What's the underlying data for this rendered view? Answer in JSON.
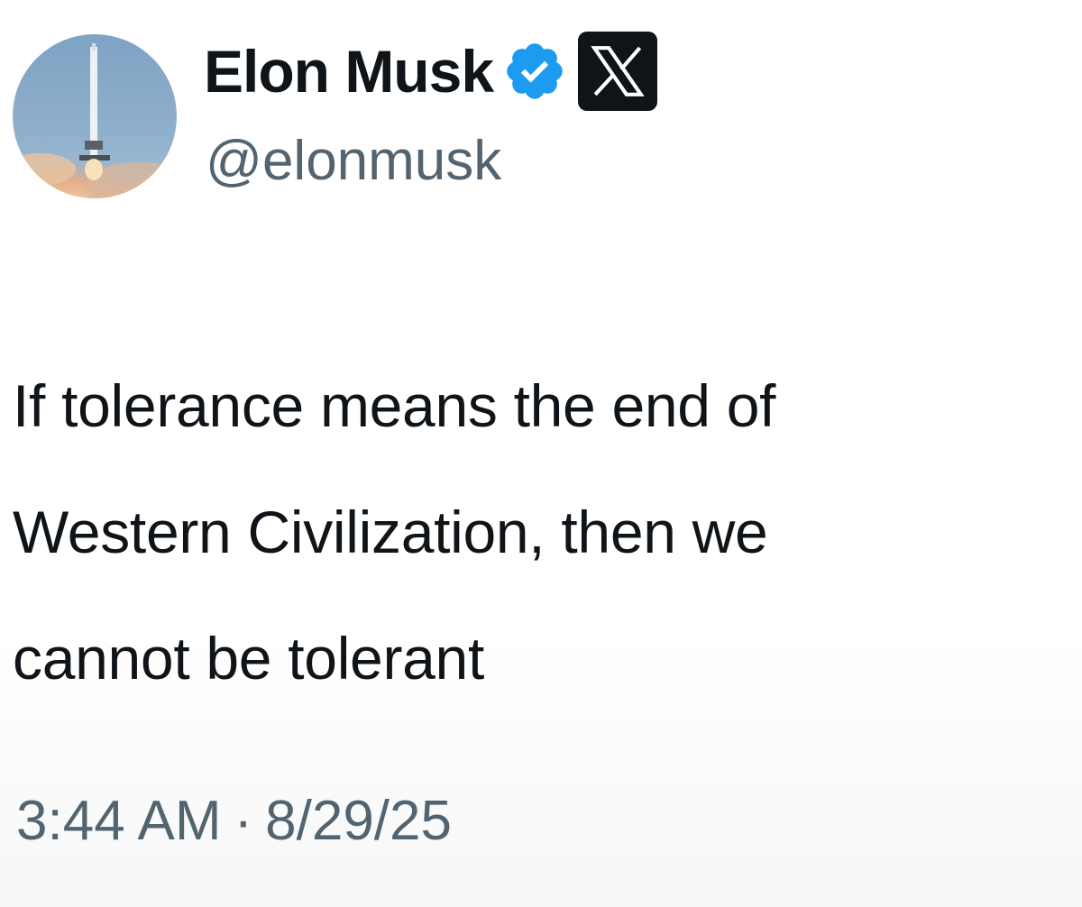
{
  "author": {
    "display_name": "Elon Musk",
    "handle": "@elonmusk",
    "avatar_icon": "rocket-launch-avatar",
    "verified_icon": "verified-badge-icon",
    "affiliation_icon": "x-logo-icon"
  },
  "tweet": {
    "lines": [
      "If tolerance means the end of",
      "Western Civilization, then we",
      "cannot be tolerant"
    ]
  },
  "meta": {
    "time": "3:44 AM",
    "separator": "·",
    "date": "8/29/25"
  },
  "colors": {
    "text": "#0f1419",
    "muted": "#536471",
    "verified_blue": "#1d9bf0",
    "x_badge_bg": "#0f1419"
  }
}
